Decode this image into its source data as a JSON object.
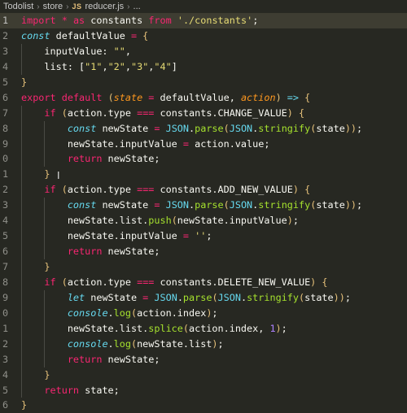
{
  "breadcrumb": {
    "items": [
      "Todolist",
      "store"
    ],
    "file_badge": "JS",
    "file": "reducer.js",
    "more": "..."
  },
  "editor": {
    "active_line": 1,
    "lines": [
      {
        "n": "1",
        "tokens": [
          [
            "kw",
            "import"
          ],
          [
            "p",
            " "
          ],
          [
            "kw",
            "*"
          ],
          [
            "p",
            " "
          ],
          [
            "kw",
            "as"
          ],
          [
            "p",
            " constants "
          ],
          [
            "kw",
            "from"
          ],
          [
            "p",
            " "
          ],
          [
            "str",
            "'./constants'"
          ],
          [
            "p",
            ";"
          ]
        ]
      },
      {
        "n": "2",
        "tokens": [
          [
            "st",
            "const"
          ],
          [
            "p",
            " defaultValue "
          ],
          [
            "op",
            "="
          ],
          [
            "p",
            " "
          ],
          [
            "bracket",
            "{"
          ]
        ]
      },
      {
        "n": "3",
        "tokens": [
          [
            "p",
            "    inputValue: "
          ],
          [
            "str",
            "\"\""
          ],
          [
            "p",
            ","
          ]
        ]
      },
      {
        "n": "4",
        "tokens": [
          [
            "p",
            "    list: ["
          ],
          [
            "str",
            "\"1\""
          ],
          [
            "p",
            ","
          ],
          [
            "str",
            "\"2\""
          ],
          [
            "p",
            ","
          ],
          [
            "str",
            "\"3\""
          ],
          [
            "p",
            ","
          ],
          [
            "str",
            "\"4\""
          ],
          [
            "p",
            "]"
          ]
        ]
      },
      {
        "n": "5",
        "tokens": [
          [
            "bracket",
            "}"
          ]
        ]
      },
      {
        "n": "6",
        "tokens": [
          [
            "kw",
            "export"
          ],
          [
            "p",
            " "
          ],
          [
            "kw",
            "default"
          ],
          [
            "p",
            " "
          ],
          [
            "bracket",
            "("
          ],
          [
            "param",
            "state"
          ],
          [
            "p",
            " "
          ],
          [
            "op",
            "="
          ],
          [
            "p",
            " defaultValue, "
          ],
          [
            "param",
            "action"
          ],
          [
            "bracket",
            ")"
          ],
          [
            "p",
            " "
          ],
          [
            "st",
            "=>"
          ],
          [
            "p",
            " "
          ],
          [
            "bracket",
            "{"
          ]
        ]
      },
      {
        "n": "7",
        "tokens": [
          [
            "p",
            "    "
          ],
          [
            "kw",
            "if"
          ],
          [
            "p",
            " "
          ],
          [
            "bracket",
            "("
          ],
          [
            "p",
            "action.type "
          ],
          [
            "op",
            "==="
          ],
          [
            "p",
            " constants.CHANGE_VALUE"
          ],
          [
            "bracket",
            ")"
          ],
          [
            "p",
            " "
          ],
          [
            "bracket",
            "{"
          ]
        ]
      },
      {
        "n": "8",
        "tokens": [
          [
            "p",
            "        "
          ],
          [
            "st",
            "const"
          ],
          [
            "p",
            " newState "
          ],
          [
            "op",
            "="
          ],
          [
            "p",
            " "
          ],
          [
            "const",
            "JSON"
          ],
          [
            "p",
            "."
          ],
          [
            "fn",
            "parse"
          ],
          [
            "bracket",
            "("
          ],
          [
            "const",
            "JSON"
          ],
          [
            "p",
            "."
          ],
          [
            "fn",
            "stringify"
          ],
          [
            "bracket",
            "("
          ],
          [
            "p",
            "state"
          ],
          [
            "bracket",
            "))"
          ],
          [
            "p",
            ";"
          ]
        ]
      },
      {
        "n": "9",
        "tokens": [
          [
            "p",
            "        newState.inputValue "
          ],
          [
            "op",
            "="
          ],
          [
            "p",
            " action.value;"
          ]
        ]
      },
      {
        "n": "0",
        "tokens": [
          [
            "p",
            "        "
          ],
          [
            "kw",
            "return"
          ],
          [
            "p",
            " newState;"
          ]
        ]
      },
      {
        "n": "1",
        "tokens": [
          [
            "p",
            "    "
          ],
          [
            "bracket",
            "}"
          ]
        ]
      },
      {
        "n": "2",
        "tokens": [
          [
            "p",
            "    "
          ],
          [
            "kw",
            "if"
          ],
          [
            "p",
            " "
          ],
          [
            "bracket",
            "("
          ],
          [
            "p",
            "action.type "
          ],
          [
            "op",
            "==="
          ],
          [
            "p",
            " constants.ADD_NEW_VALUE"
          ],
          [
            "bracket",
            ")"
          ],
          [
            "p",
            " "
          ],
          [
            "bracket",
            "{"
          ]
        ]
      },
      {
        "n": "3",
        "tokens": [
          [
            "p",
            "        "
          ],
          [
            "st",
            "const"
          ],
          [
            "p",
            " newState "
          ],
          [
            "op",
            "="
          ],
          [
            "p",
            " "
          ],
          [
            "const",
            "JSON"
          ],
          [
            "p",
            "."
          ],
          [
            "fn",
            "parse"
          ],
          [
            "bracket",
            "("
          ],
          [
            "const",
            "JSON"
          ],
          [
            "p",
            "."
          ],
          [
            "fn",
            "stringify"
          ],
          [
            "bracket",
            "("
          ],
          [
            "p",
            "state"
          ],
          [
            "bracket",
            "))"
          ],
          [
            "p",
            ";"
          ]
        ]
      },
      {
        "n": "4",
        "tokens": [
          [
            "p",
            "        newState.list."
          ],
          [
            "fn",
            "push"
          ],
          [
            "bracket",
            "("
          ],
          [
            "p",
            "newState.inputValue"
          ],
          [
            "bracket",
            ")"
          ],
          [
            "p",
            ";"
          ]
        ]
      },
      {
        "n": "5",
        "tokens": [
          [
            "p",
            "        newState.inputValue "
          ],
          [
            "op",
            "="
          ],
          [
            "p",
            " "
          ],
          [
            "str",
            "''"
          ],
          [
            "p",
            ";"
          ]
        ]
      },
      {
        "n": "6",
        "tokens": [
          [
            "p",
            "        "
          ],
          [
            "kw",
            "return"
          ],
          [
            "p",
            " newState;"
          ]
        ]
      },
      {
        "n": "7",
        "tokens": [
          [
            "p",
            "    "
          ],
          [
            "bracket",
            "}"
          ]
        ]
      },
      {
        "n": "8",
        "tokens": [
          [
            "p",
            "    "
          ],
          [
            "kw",
            "if"
          ],
          [
            "p",
            " "
          ],
          [
            "bracket",
            "("
          ],
          [
            "p",
            "action.type "
          ],
          [
            "op",
            "==="
          ],
          [
            "p",
            " constants.DELETE_NEW_VALUE"
          ],
          [
            "bracket",
            ")"
          ],
          [
            "p",
            " "
          ],
          [
            "bracket",
            "{"
          ]
        ]
      },
      {
        "n": "9",
        "tokens": [
          [
            "p",
            "        "
          ],
          [
            "st",
            "let"
          ],
          [
            "p",
            " newState "
          ],
          [
            "op",
            "="
          ],
          [
            "p",
            " "
          ],
          [
            "const",
            "JSON"
          ],
          [
            "p",
            "."
          ],
          [
            "fn",
            "parse"
          ],
          [
            "bracket",
            "("
          ],
          [
            "const",
            "JSON"
          ],
          [
            "p",
            "."
          ],
          [
            "fn",
            "stringify"
          ],
          [
            "bracket",
            "("
          ],
          [
            "p",
            "state"
          ],
          [
            "bracket",
            "))"
          ],
          [
            "p",
            ";"
          ]
        ]
      },
      {
        "n": "0",
        "tokens": [
          [
            "p",
            "        "
          ],
          [
            "st",
            "console"
          ],
          [
            "p",
            "."
          ],
          [
            "fn",
            "log"
          ],
          [
            "bracket",
            "("
          ],
          [
            "p",
            "action.index"
          ],
          [
            "bracket",
            ")"
          ],
          [
            "p",
            ";"
          ]
        ]
      },
      {
        "n": "1",
        "tokens": [
          [
            "p",
            "        newState.list."
          ],
          [
            "fn",
            "splice"
          ],
          [
            "bracket",
            "("
          ],
          [
            "p",
            "action.index, "
          ],
          [
            "num",
            "1"
          ],
          [
            "bracket",
            ")"
          ],
          [
            "p",
            ";"
          ]
        ]
      },
      {
        "n": "2",
        "tokens": [
          [
            "p",
            "        "
          ],
          [
            "st",
            "console"
          ],
          [
            "p",
            "."
          ],
          [
            "fn",
            "log"
          ],
          [
            "bracket",
            "("
          ],
          [
            "p",
            "newState.list"
          ],
          [
            "bracket",
            ")"
          ],
          [
            "p",
            ";"
          ]
        ]
      },
      {
        "n": "3",
        "tokens": [
          [
            "p",
            "        "
          ],
          [
            "kw",
            "return"
          ],
          [
            "p",
            " newState;"
          ]
        ]
      },
      {
        "n": "4",
        "tokens": [
          [
            "p",
            "    "
          ],
          [
            "bracket",
            "}"
          ]
        ]
      },
      {
        "n": "5",
        "tokens": [
          [
            "p",
            "    "
          ],
          [
            "kw",
            "return"
          ],
          [
            "p",
            " state;"
          ]
        ]
      },
      {
        "n": "6",
        "tokens": [
          [
            "bracket",
            "}"
          ]
        ]
      }
    ]
  }
}
